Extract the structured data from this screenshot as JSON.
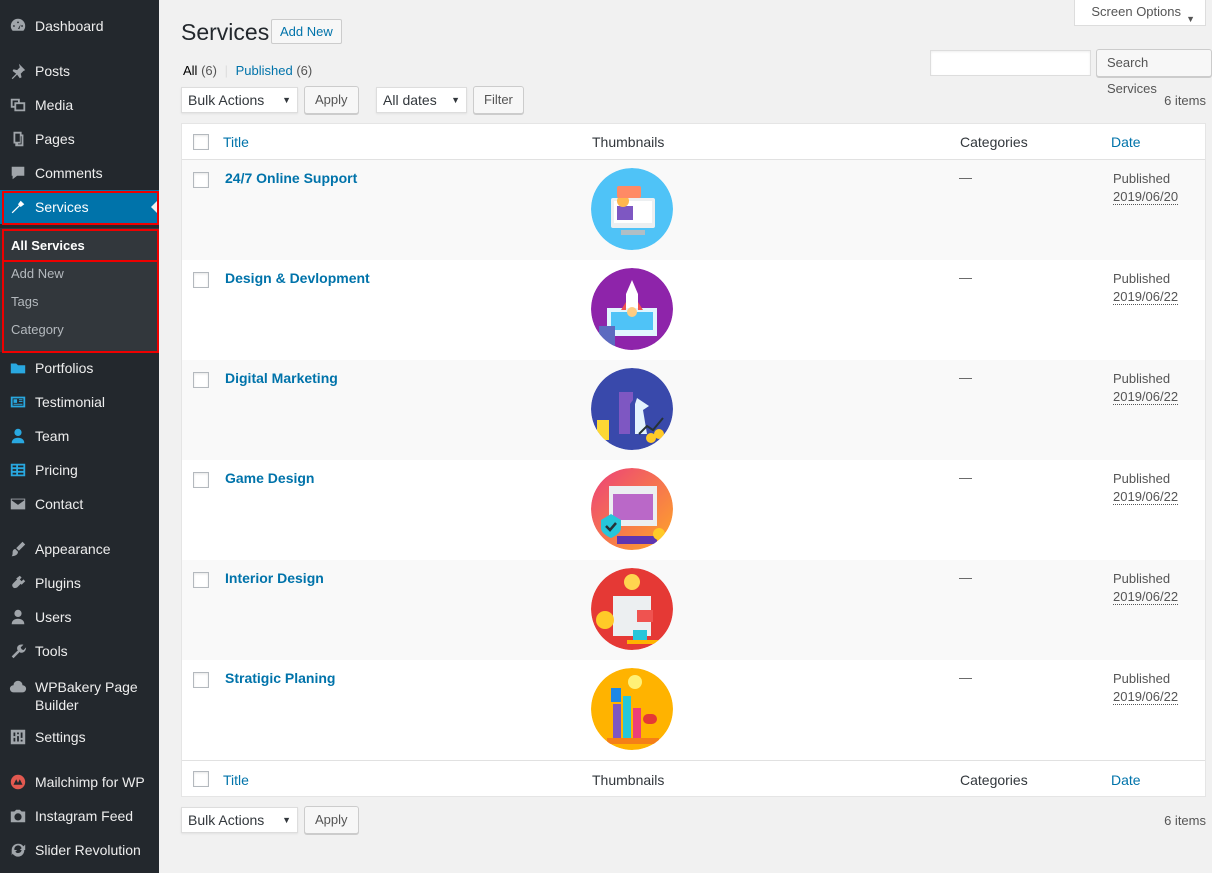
{
  "sidebar": {
    "menu": [
      {
        "label": "Dashboard",
        "icon": "dashboard-icon"
      },
      {
        "label": "Posts",
        "icon": "pin-icon"
      },
      {
        "label": "Media",
        "icon": "media-icon"
      },
      {
        "label": "Pages",
        "icon": "pages-icon"
      },
      {
        "label": "Comments",
        "icon": "comment-icon"
      },
      {
        "label": "Services",
        "icon": "hammer-icon"
      },
      {
        "label": "Portfolios",
        "icon": "folder-icon"
      },
      {
        "label": "Testimonial",
        "icon": "id-card-icon"
      },
      {
        "label": "Team",
        "icon": "person-icon"
      },
      {
        "label": "Pricing",
        "icon": "table-icon"
      },
      {
        "label": "Contact",
        "icon": "envelope-icon"
      },
      {
        "label": "Appearance",
        "icon": "brush-icon"
      },
      {
        "label": "Plugins",
        "icon": "plug-icon"
      },
      {
        "label": "Users",
        "icon": "users-icon"
      },
      {
        "label": "Tools",
        "icon": "wrench-icon"
      },
      {
        "label": "WPBakery Page Builder",
        "icon": "cloud-icon"
      },
      {
        "label": "Settings",
        "icon": "sliders-icon"
      },
      {
        "label": "Mailchimp for WP",
        "icon": "mailchimp-icon"
      },
      {
        "label": "Instagram Feed",
        "icon": "camera-icon"
      },
      {
        "label": "Slider Revolution",
        "icon": "refresh-icon"
      }
    ],
    "submenu": [
      "All Services",
      "Add New",
      "Tags",
      "Category"
    ]
  },
  "header": {
    "title": "Services",
    "add_new": "Add New",
    "screen_options": "Screen Options"
  },
  "filters": {
    "all_label": "All",
    "all_count": "(6)",
    "separator": "|",
    "published_label": "Published",
    "published_count": "(6)"
  },
  "search": {
    "value": "",
    "button": "Search Services"
  },
  "tablenav": {
    "bulk_actions": "Bulk Actions",
    "apply": "Apply",
    "dates": "All dates",
    "filter": "Filter",
    "items": "6 items"
  },
  "columns": {
    "title": "Title",
    "thumbnails": "Thumbnails",
    "categories": "Categories",
    "date": "Date"
  },
  "rows": [
    {
      "title": "24/7 Online Support",
      "categories": "—",
      "status": "Published",
      "date": "2019/06/20",
      "thumb_colors": [
        "#29b6f6",
        "#4dd0e1"
      ]
    },
    {
      "title": "Design & Devlopment",
      "categories": "—",
      "status": "Published",
      "date": "2019/06/22",
      "thumb_colors": [
        "#7b1fa2",
        "#ab47bc"
      ]
    },
    {
      "title": "Digital Marketing",
      "categories": "—",
      "status": "Published",
      "date": "2019/06/22",
      "thumb_colors": [
        "#303f9f",
        "#5c6bc0"
      ]
    },
    {
      "title": "Game Design",
      "categories": "—",
      "status": "Published",
      "date": "2019/06/22",
      "thumb_colors": [
        "#ec407a",
        "#ffa726"
      ]
    },
    {
      "title": "Interior Design",
      "categories": "—",
      "status": "Published",
      "date": "2019/06/22",
      "thumb_colors": [
        "#e53935",
        "#ef5350"
      ]
    },
    {
      "title": "Stratigic Planing",
      "categories": "—",
      "status": "Published",
      "date": "2019/06/22",
      "thumb_colors": [
        "#ffb300",
        "#ffca28"
      ]
    }
  ],
  "colors": {
    "accent": "#0073aa",
    "sidebar_bg": "#23282d",
    "highlight_box": "#e00000"
  }
}
